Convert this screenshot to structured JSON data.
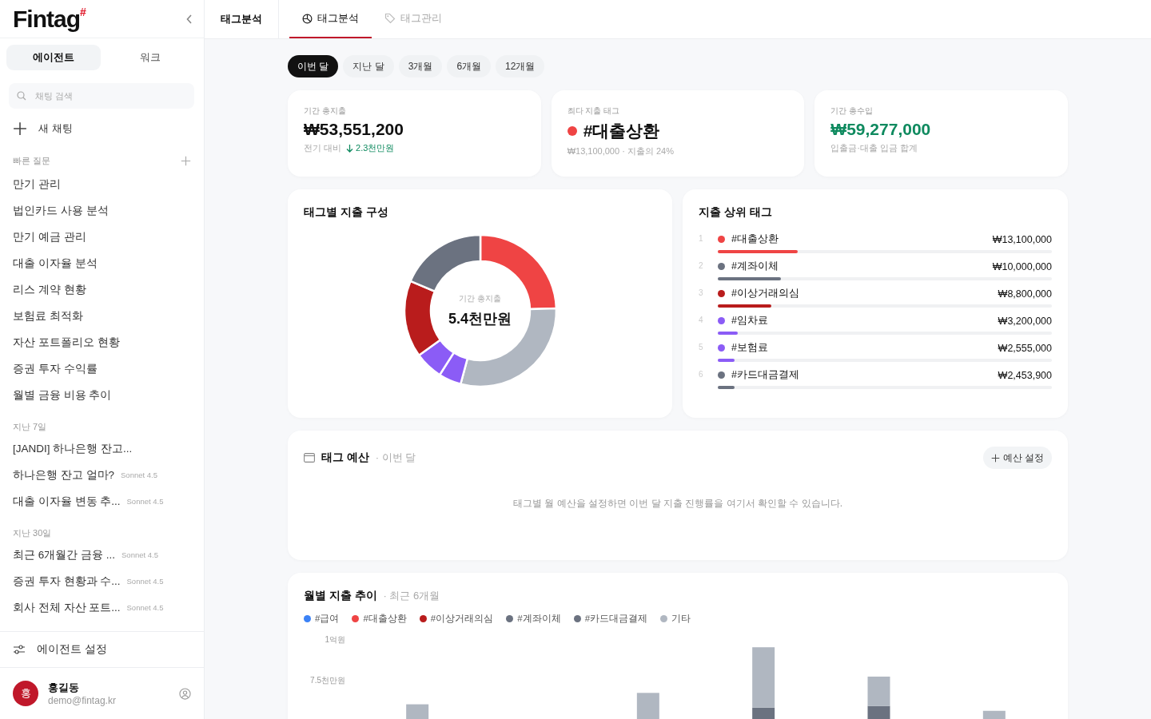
{
  "sidebar": {
    "logo": {
      "name": "Fintag",
      "mark": "#"
    },
    "tabs": [
      {
        "label": "에이전트",
        "selected": true
      },
      {
        "label": "워크",
        "selected": false
      }
    ],
    "search": {
      "placeholder": "채팅 검색"
    },
    "new_chat": "새 채팅",
    "quick_questions": {
      "title": "빠른 질문",
      "items": [
        "만기 관리",
        "법인카드 사용 분석",
        "만기 예금 관리",
        "대출 이자율 분석",
        "리스 계약 현황",
        "보험료 최적화",
        "자산 포트폴리오 현황",
        "증권 투자 수익률",
        "월별 금융 비용 추이"
      ]
    },
    "history": [
      {
        "title": "지난 7일",
        "items": [
          {
            "title": "[JANDI] 하나은행 잔고..."
          },
          {
            "title": "하나은행 잔고 얼마?",
            "model": "Sonnet 4.5"
          },
          {
            "title": "대출 이자율 변동 추...",
            "model": "Sonnet 4.5"
          }
        ]
      },
      {
        "title": "지난 30일",
        "items": [
          {
            "title": "최근 6개월간 금융 ...",
            "model": "Sonnet 4.5"
          },
          {
            "title": "증권 투자 현황과 수...",
            "model": "Sonnet 4.5"
          },
          {
            "title": "회사 전체 자산 포트...",
            "model": "Sonnet 4.5"
          }
        ]
      }
    ],
    "settings": "에이전트 설정",
    "user": {
      "initial": "홍",
      "name": "홍길동",
      "email": "demo@fintag.kr"
    }
  },
  "header": {
    "title": "태그분석",
    "tabs": [
      {
        "label": "태그분석",
        "selected": true
      },
      {
        "label": "태그관리",
        "selected": false
      }
    ]
  },
  "periods": [
    {
      "label": "이번 달",
      "selected": true
    },
    {
      "label": "지난 달",
      "selected": false
    },
    {
      "label": "3개월",
      "selected": false
    },
    {
      "label": "6개월",
      "selected": false
    },
    {
      "label": "12개월",
      "selected": false
    }
  ],
  "stats": [
    {
      "label": "기간 총지출",
      "value": "₩53,551,200",
      "positive": false,
      "note": "전기 대비",
      "delta": "2.3천만원"
    },
    {
      "label": "최다 지출 태그",
      "value": "#대출상환",
      "color": "#ef4444",
      "positive": false,
      "note": "₩13,100,000 · 지출의 24%"
    },
    {
      "label": "기간 총수입",
      "value": "₩59,277,000",
      "positive": true,
      "note": "입출금·대출 입금 합계"
    }
  ],
  "composition": {
    "title": "태그별 지출 구성",
    "center_label": "기간 총지출",
    "center_value": "5.4천만원"
  },
  "top_tags": {
    "title": "지출 상위 태그",
    "items": [
      {
        "rank": "1",
        "name": "#대출상환",
        "amount": "₩13,100,000",
        "color": "#ef4444",
        "level": 0.24
      },
      {
        "rank": "2",
        "name": "#계좌이체",
        "amount": "₩10,000,000",
        "color": "#6b7280",
        "level": 0.19
      },
      {
        "rank": "3",
        "name": "#이상거래의심",
        "amount": "₩8,800,000",
        "color": "#b91c1c",
        "level": 0.16
      },
      {
        "rank": "4",
        "name": "#임차료",
        "amount": "₩3,200,000",
        "color": "#8b5cf6",
        "level": 0.06
      },
      {
        "rank": "5",
        "name": "#보험료",
        "amount": "₩2,555,000",
        "color": "#8b5cf6",
        "level": 0.05
      },
      {
        "rank": "6",
        "name": "#카드대금결제",
        "amount": "₩2,453,900",
        "color": "#6b7280",
        "level": 0.05
      }
    ]
  },
  "budget": {
    "title": "태그 예산",
    "subtitle": "· 이번 달",
    "button": "예산 설정",
    "empty": "태그별 월 예산을 설정하면 이번 달 지출 진행률을 여기서 확인할 수 있습니다."
  },
  "trend": {
    "title": "월별 지출 추이",
    "subtitle": "· 최근 6개월",
    "legend": [
      {
        "name": "#급여",
        "color": "#3b82f6"
      },
      {
        "name": "#대출상환",
        "color": "#ef4444"
      },
      {
        "name": "#이상거래의심",
        "color": "#b91c1c"
      },
      {
        "name": "#계좌이체",
        "color": "#6b7280"
      },
      {
        "name": "#카드대금결제",
        "color": "#6b7280"
      },
      {
        "name": "기타",
        "color": "#b0b7c1"
      }
    ],
    "axis_labels": [
      "1억원",
      "7.5천만원"
    ]
  }
}
